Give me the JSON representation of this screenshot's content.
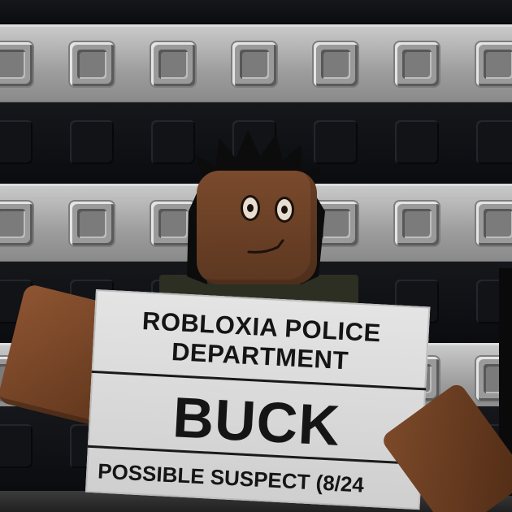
{
  "sign": {
    "line1": "ROBLOXIA POLICE",
    "line2": "DEPARTMENT",
    "name": "BUCK",
    "footer": "POSSIBLE SUSPECT (8/24"
  },
  "colors": {
    "wall_light": "#a8a8a8",
    "wall_dark": "#111317",
    "skin": "#6e4228",
    "sign_board": "#dcdcdc",
    "sign_text": "#151515"
  }
}
